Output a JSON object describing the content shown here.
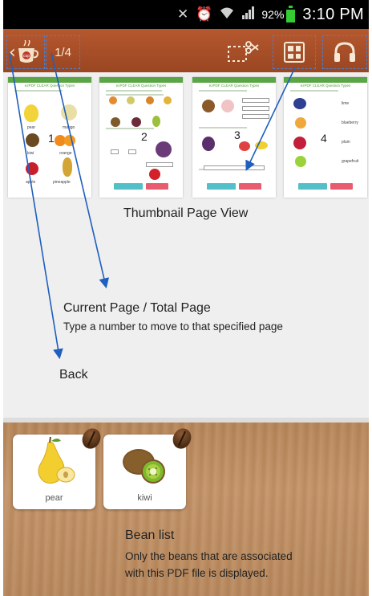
{
  "status_bar": {
    "icons": [
      "mute-vibrate-icon",
      "alarm-icon",
      "wifi-icon",
      "signal-icon"
    ],
    "battery_percent": "92%",
    "time": "3:10 PM"
  },
  "app_bar": {
    "page_indicator": "1/4",
    "back_icon": "cup-logo-icon",
    "buttons": [
      "clip-icon",
      "grid-view-icon",
      "headphones-icon"
    ]
  },
  "thumbnails": [
    {
      "title": "ezPDF CLEAR Question Types",
      "number": "1",
      "labels": [
        "pear",
        "kiwi",
        "orange",
        "apple",
        "pineapple",
        "mango"
      ]
    },
    {
      "title": "ezPDF CLEAR Question Types",
      "number": "2",
      "labels": [
        "Check",
        "Clear"
      ]
    },
    {
      "title": "ezPDF CLEAR Question Types",
      "number": "3",
      "labels": [
        "Check",
        "Clear"
      ]
    },
    {
      "title": "ezPDF CLEAR Question Types",
      "number": "4",
      "labels": [
        "lime",
        "blueberry",
        "plum",
        "grapefruit",
        "Check",
        "Clear"
      ]
    }
  ],
  "annotations": {
    "thumbnail_view": "Thumbnail Page View",
    "page_title": "Current Page / Total Page",
    "page_sub": "Type a number to move to that specified page",
    "back": "Back",
    "bean_title": "Bean list",
    "bean_sub_1": "Only the beans that are associated",
    "bean_sub_2": "with this PDF file is displayed."
  },
  "beans": [
    {
      "label": "pear"
    },
    {
      "label": "kiwi"
    }
  ],
  "colors": {
    "app_bar": "#a54e27",
    "callout_arrow": "#1f5fbf",
    "thumb_header": "#5aa546",
    "check_button": "#52c0c8",
    "clear_button": "#e95b6e"
  }
}
